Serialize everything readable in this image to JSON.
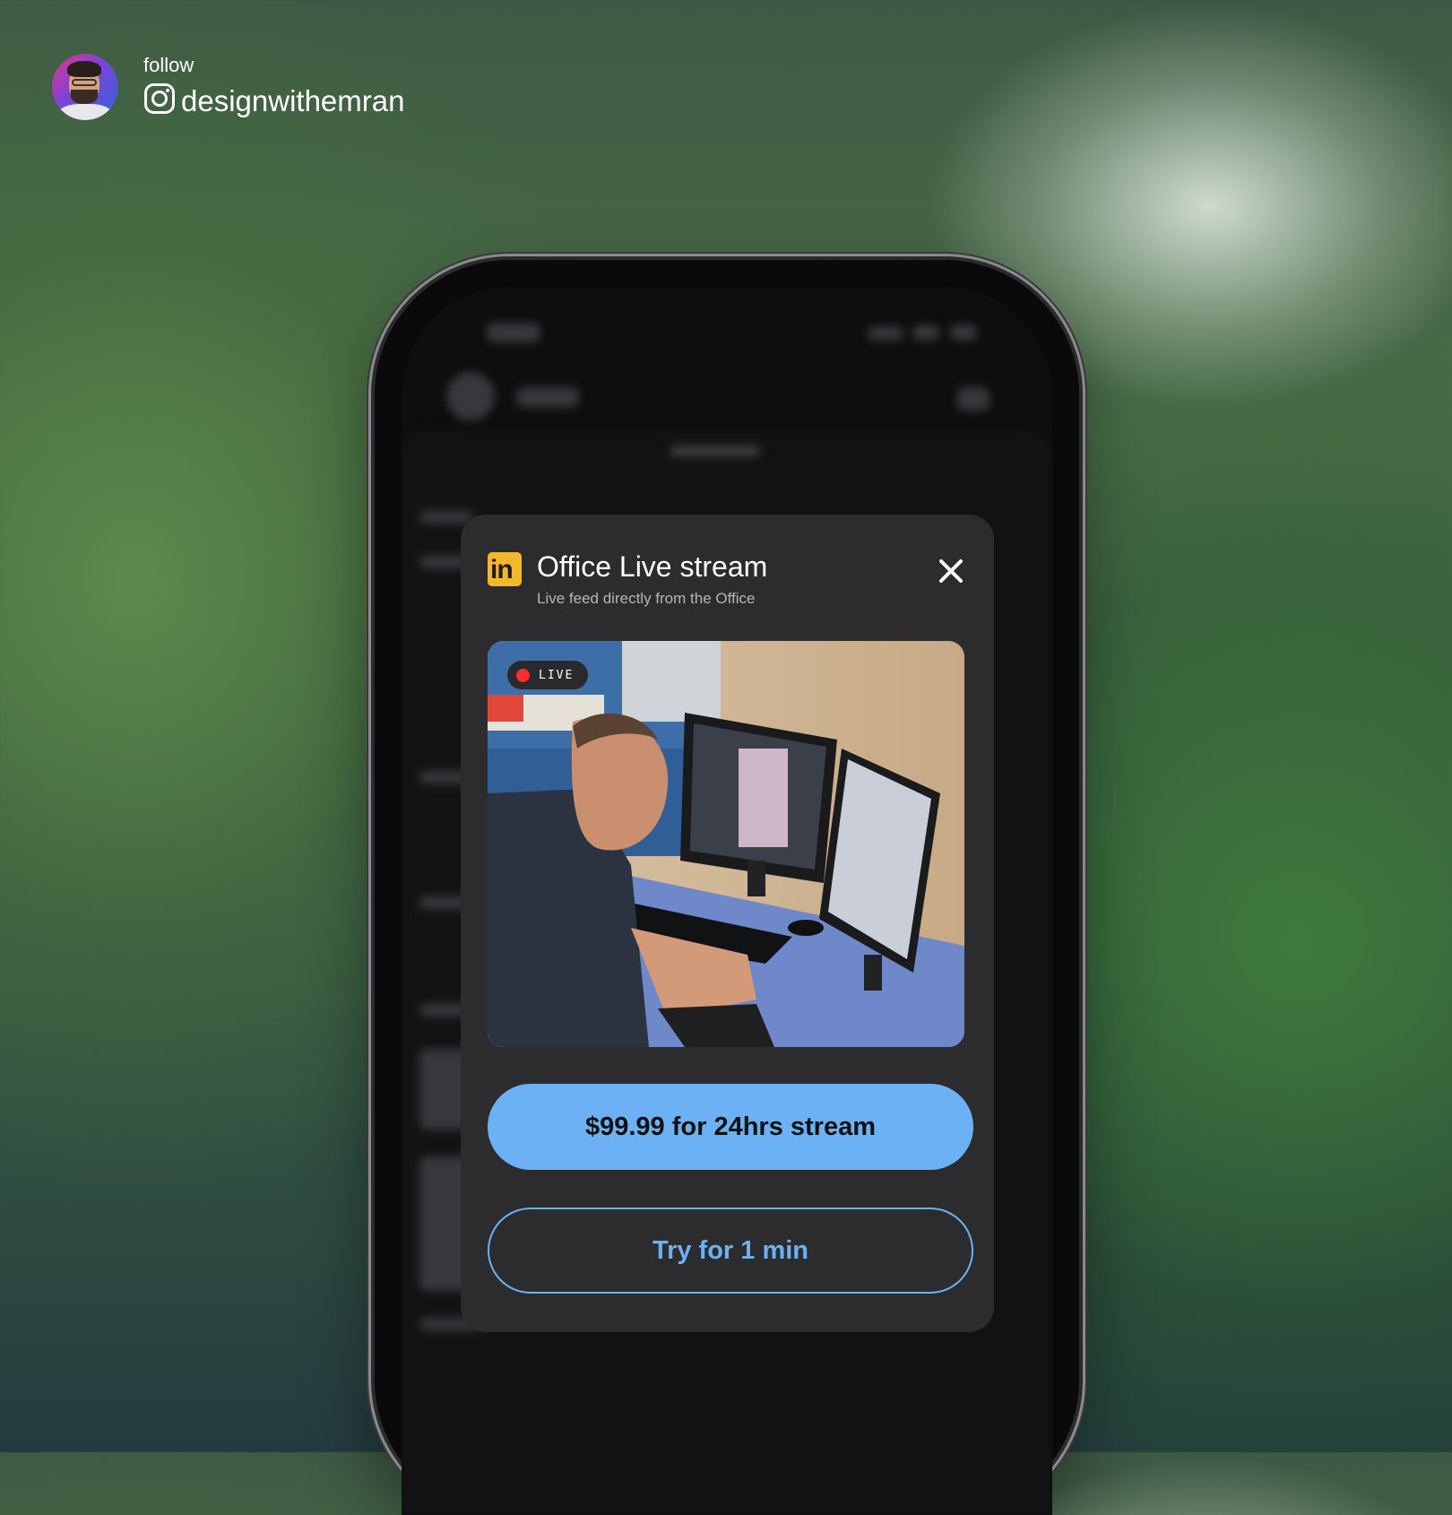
{
  "follow": {
    "label": "follow",
    "handle": "designwithemran",
    "avatar_icon": "profile-avatar",
    "social_icon": "instagram-icon"
  },
  "dialog": {
    "brand_icon": "linkedin-icon",
    "brand_logo_text": "in",
    "title": "Office Live stream",
    "subtitle": "Live feed directly from the Office",
    "close_icon": "close-icon",
    "live_badge": "LIVE",
    "primary_button": "$99.99 for 24hrs stream",
    "secondary_button": "Try for 1 min"
  },
  "colors": {
    "accent": "#6db1f5",
    "dialog_bg": "#2c2c2e",
    "brand": "#f4b82a",
    "live": "#ff2d2d"
  }
}
